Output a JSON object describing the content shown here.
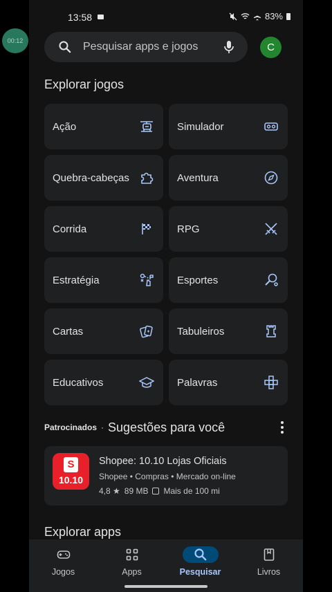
{
  "status_bar": {
    "time": "13:58",
    "battery": "83%"
  },
  "recording_bubble": "00:12",
  "search": {
    "placeholder": "Pesquisar apps e jogos"
  },
  "account": {
    "initial": "C",
    "color": "#22862e"
  },
  "explore_games": {
    "title": "Explorar jogos",
    "categories": [
      {
        "label": "Ação",
        "icon": "helicopter-icon"
      },
      {
        "label": "Simulador",
        "icon": "vr-headset-icon"
      },
      {
        "label": "Quebra-cabeças",
        "icon": "puzzle-piece-icon"
      },
      {
        "label": "Aventura",
        "icon": "compass-icon"
      },
      {
        "label": "Corrida",
        "icon": "checkered-flag-icon"
      },
      {
        "label": "RPG",
        "icon": "crossed-swords-icon"
      },
      {
        "label": "Estratégia",
        "icon": "strategy-play-icon"
      },
      {
        "label": "Esportes",
        "icon": "sports-racket-icon"
      },
      {
        "label": "Cartas",
        "icon": "playing-cards-icon"
      },
      {
        "label": "Tabuleiros",
        "icon": "chess-rook-icon"
      },
      {
        "label": "Educativos",
        "icon": "graduation-cap-icon"
      },
      {
        "label": "Palavras",
        "icon": "word-tiles-icon"
      }
    ]
  },
  "sponsored": {
    "tag": "Patrocinados",
    "separator": "·",
    "title": "Sugestões para você",
    "app": {
      "name": "Shopee: 10.10 Lojas Oficiais",
      "meta": "Shopee • Compras • Mercado on-line",
      "rating": "4,8 ★",
      "size": "89 MB",
      "downloads": "Mais de 100 mi",
      "icon_badge": "S",
      "icon_promo": "10.10",
      "icon_color": "#e8202a"
    }
  },
  "explore_apps": {
    "title": "Explorar apps"
  },
  "bottom_nav": [
    {
      "label": "Jogos",
      "icon": "gamepad-icon",
      "active": false
    },
    {
      "label": "Apps",
      "icon": "apps-grid-icon",
      "active": false
    },
    {
      "label": "Pesquisar",
      "icon": "search-icon",
      "active": true
    },
    {
      "label": "Livros",
      "icon": "bookmark-book-icon",
      "active": false
    }
  ],
  "colors": {
    "background": "#131314",
    "tile": "#1f2021",
    "accent": "#a8c7fa",
    "active_pill": "#004a77"
  }
}
